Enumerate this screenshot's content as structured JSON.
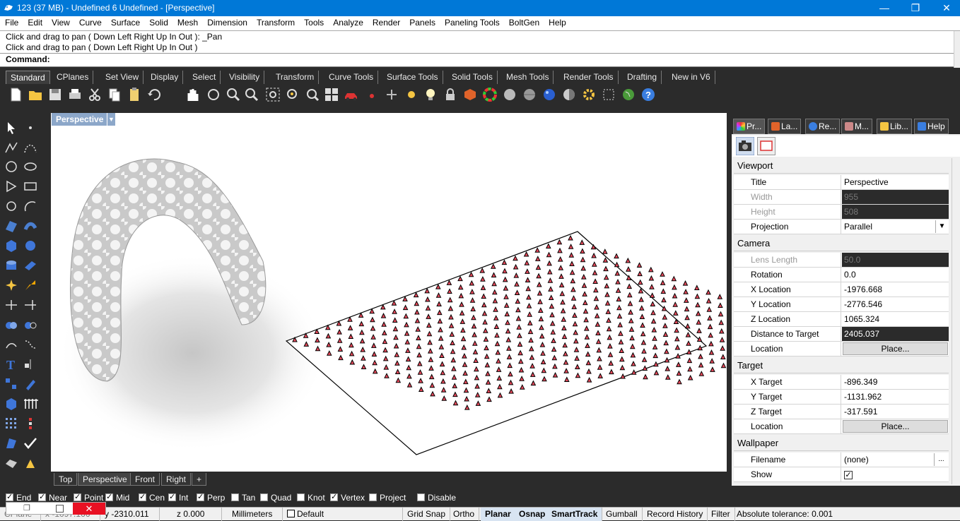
{
  "window": {
    "title": "123 (37 MB) - Undefined 6 Undefined - [Perspective]",
    "min_glyph": "—",
    "restore_glyph": "❐",
    "close_glyph": "✕"
  },
  "menu": [
    "File",
    "Edit",
    "View",
    "Curve",
    "Surface",
    "Solid",
    "Mesh",
    "Dimension",
    "Transform",
    "Tools",
    "Analyze",
    "Render",
    "Panels",
    "Paneling Tools",
    "BoltGen",
    "Help"
  ],
  "command": {
    "history": [
      "Click and drag to pan ( Down  Left  Right  Up  In  Out ): _Pan",
      "Click and drag to pan ( Down  Left  Right  Up  In  Out )"
    ],
    "prompt": "Command:"
  },
  "toolbar_tabs": [
    "Standard",
    "CPlanes",
    "Set View",
    "Display",
    "Select",
    "Visibility",
    "Transform",
    "Curve Tools",
    "Surface Tools",
    "Solid Tools",
    "Mesh Tools",
    "Render Tools",
    "Drafting",
    "New in V6"
  ],
  "viewport": {
    "name": "Perspective",
    "tabs": [
      "Top",
      "Perspective",
      "Front",
      "Right"
    ],
    "add_tab": "+"
  },
  "panel": {
    "tabs": [
      "Pr...",
      "La...",
      "Re...",
      "M...",
      "Lib...",
      "Help"
    ],
    "sections": {
      "viewport": "Viewport",
      "camera": "Camera",
      "target": "Target",
      "wallpaper": "Wallpaper"
    },
    "rows": {
      "title": {
        "label": "Title",
        "value": "Perspective"
      },
      "width": {
        "label": "Width",
        "value": "955"
      },
      "height": {
        "label": "Height",
        "value": "508"
      },
      "projection": {
        "label": "Projection",
        "value": "Parallel"
      },
      "lens": {
        "label": "Lens Length",
        "value": "50.0"
      },
      "rotation": {
        "label": "Rotation",
        "value": "0.0"
      },
      "xloc": {
        "label": "X Location",
        "value": "-1976.668"
      },
      "yloc": {
        "label": "Y Location",
        "value": "-2776.546"
      },
      "zloc": {
        "label": "Z Location",
        "value": "1065.324"
      },
      "dist": {
        "label": "Distance to Target",
        "value": "2405.037"
      },
      "camloc": {
        "label": "Location",
        "button": "Place..."
      },
      "xtgt": {
        "label": "X Target",
        "value": "-896.349"
      },
      "ytgt": {
        "label": "Y Target",
        "value": "-1131.962"
      },
      "ztgt": {
        "label": "Z Target",
        "value": "-317.591"
      },
      "tgtloc": {
        "label": "Location",
        "button": "Place..."
      },
      "filename": {
        "label": "Filename",
        "value": "(none)",
        "button": "..."
      },
      "show": {
        "label": "Show",
        "checked": true
      }
    }
  },
  "osnaps": [
    {
      "label": "End",
      "checked": true
    },
    {
      "label": "Near",
      "checked": true
    },
    {
      "label": "Point",
      "checked": true
    },
    {
      "label": "Mid",
      "checked": true
    },
    {
      "label": "Cen",
      "checked": true
    },
    {
      "label": "Int",
      "checked": true
    },
    {
      "label": "Perp",
      "checked": true
    },
    {
      "label": "Tan",
      "checked": false
    },
    {
      "label": "Quad",
      "checked": false
    },
    {
      "label": "Knot",
      "checked": false
    },
    {
      "label": "Vertex",
      "checked": true
    },
    {
      "label": "Project",
      "checked": false
    },
    {
      "label": "Disable",
      "checked": false
    }
  ],
  "status": {
    "cplane": "CPlane",
    "x": "x -1097.166",
    "y": "y -2310.011",
    "z": "z 0.000",
    "units": "Millimeters",
    "layer": "Default",
    "grid_snap": "Grid Snap",
    "ortho": "Ortho",
    "planar": "Planar",
    "osnap": "Osnap",
    "smarttrack": "SmartTrack",
    "gumball": "Gumball",
    "record_history": "Record History",
    "filter": "Filter",
    "tolerance": "Absolute tolerance: 0.001"
  },
  "colors": {
    "titlebar": "#0078d7",
    "dark_ui": "#2b2b2b",
    "viewport_label": "#8ca7c9",
    "fin_red": "#e8485a"
  },
  "icons": [
    "new-file-icon",
    "open-file-icon",
    "save-icon",
    "print-icon",
    "cut-icon",
    "copy-icon",
    "paste-icon",
    "undo-icon",
    "pan-icon",
    "rotate-view-icon",
    "zoom-window-icon",
    "zoom-dynamic-icon",
    "zoom-extents-icon",
    "zoom-selected-icon",
    "four-viewports-icon",
    "car-icon",
    "dot-icon",
    "point-icon",
    "light-icon",
    "lock-icon",
    "color-icon",
    "color-wheel-icon",
    "shaded-sphere-icon",
    "rendered-sphere-icon",
    "blue-sphere-icon",
    "material-sphere-icon",
    "gear-icon",
    "options-icon",
    "earth-icon",
    "help-icon"
  ]
}
